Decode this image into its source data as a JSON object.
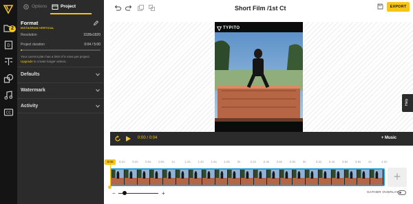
{
  "app": {
    "title": "Short Film /1st Ct"
  },
  "colors": {
    "accent": "#f5c518",
    "panel": "#2b2b2b",
    "rail": "#141414",
    "clip_border": "#2aa0d8"
  },
  "rail": {
    "logo_icon": "typito-logo-icon",
    "badge_count": "2",
    "icons": [
      "media-folder-icon",
      "document-icon",
      "text-icon",
      "shapes-icon",
      "music-icon",
      "captions-icon"
    ]
  },
  "panel": {
    "tabs": [
      {
        "label": "Options",
        "icon": "gear-icon",
        "active": false
      },
      {
        "label": "Project",
        "icon": "film-icon",
        "active": true
      }
    ],
    "format": {
      "title": "Format",
      "subtitle": "INSTAGRAM VERTICAL",
      "resolution_label": "Resolution",
      "resolution_value": "1536x1920",
      "duration_label": "Project duration",
      "duration_value": "0:04 / 5:00",
      "duration_fraction": 0.013,
      "note": "Your current plan has a limit of 5 mins per project.",
      "upgrade_link": "Upgrade",
      "note_tail": " to create longer videos."
    },
    "sections": [
      {
        "label": "Defaults"
      },
      {
        "label": "Watermark"
      },
      {
        "label": "Activity"
      }
    ]
  },
  "toolbar": {
    "export_label": "EXPORT"
  },
  "preview": {
    "brand": "TYPITO"
  },
  "help": {
    "label": "Help"
  },
  "player": {
    "current": "0:00",
    "separator": "/",
    "total": "0:04",
    "music_label": "+ Music"
  },
  "timeline": {
    "playhead_label": "0:00",
    "ticks": [
      "0.2s",
      "0.4s",
      "0.6s",
      "0.8s",
      "1s",
      "1.2s",
      "1.4s",
      "1.6s",
      "1.8s",
      "2s",
      "2.2s",
      "2.4s",
      "2.6s",
      "2.8s",
      "3s",
      "3.2s",
      "3.4s",
      "3.6s",
      "3.8s",
      "4s",
      "4.2s"
    ],
    "frame_count": 21,
    "add_label": "+",
    "zoom_minus": "−",
    "zoom_plus": "+",
    "zoom_level": 0.15,
    "gather_overlays_label": "GATHER OVERLAYS",
    "gather_overlays_on": false
  }
}
